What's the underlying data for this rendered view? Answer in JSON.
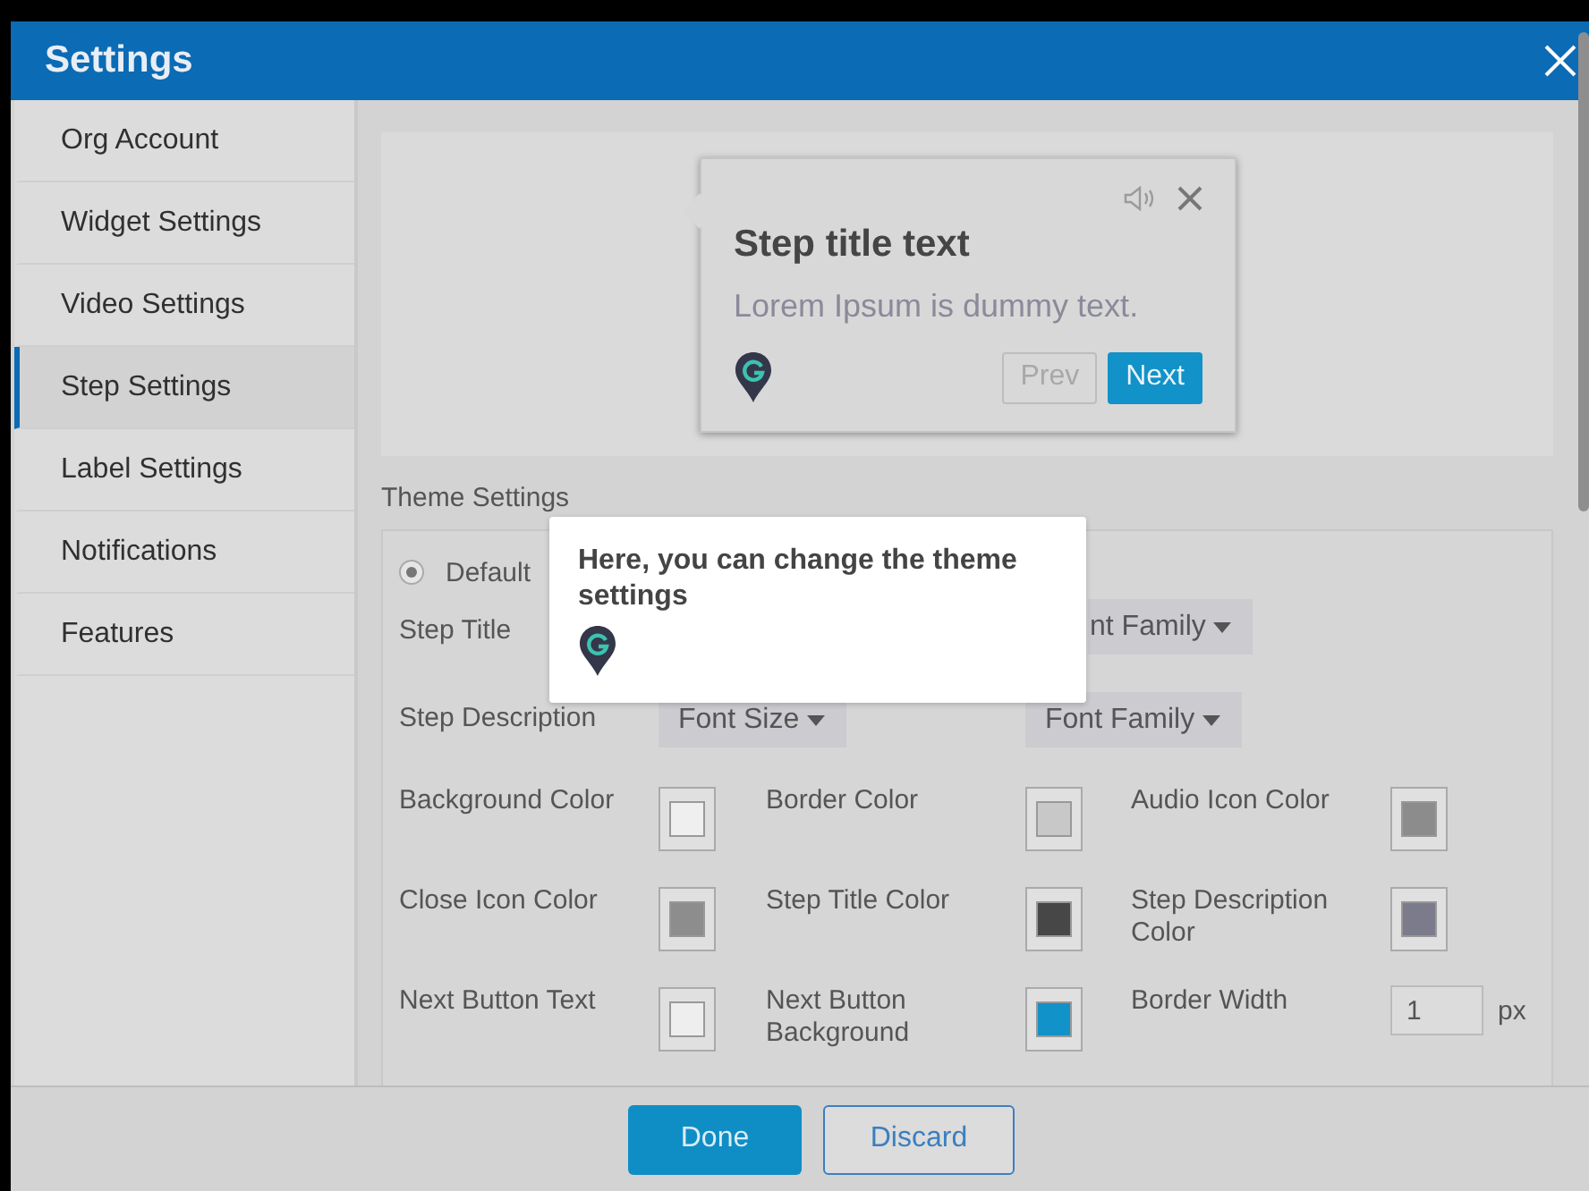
{
  "window": {
    "title": "Settings"
  },
  "sidebar": {
    "items": [
      {
        "label": "Org Account",
        "selected": false
      },
      {
        "label": "Widget Settings",
        "selected": false
      },
      {
        "label": "Video Settings",
        "selected": false
      },
      {
        "label": "Step Settings",
        "selected": true
      },
      {
        "label": "Label Settings",
        "selected": false
      },
      {
        "label": "Notifications",
        "selected": false
      },
      {
        "label": "Features",
        "selected": false
      }
    ]
  },
  "preview": {
    "title": "Step title text",
    "description": "Lorem Ipsum is dummy text.",
    "buttons": [
      {
        "label": "Prev",
        "kind": "secondary"
      },
      {
        "label": "Next",
        "kind": "primary"
      }
    ]
  },
  "theme": {
    "heading": "Theme Settings",
    "options": [
      {
        "label": "Default",
        "selected": true
      }
    ],
    "font_rows": [
      {
        "label": "Step Title",
        "font_family": "nt Family"
      },
      {
        "label": "Step Description",
        "font_size": "Font Size",
        "font_family": "Font Family"
      }
    ],
    "color_settings": [
      {
        "label": "Background Color",
        "kind": "swatch",
        "color": "#efefef"
      },
      {
        "label": "Border Color",
        "kind": "swatch",
        "color": "#c8c8c8"
      },
      {
        "label": "Audio Icon Color",
        "kind": "swatch",
        "color": "#8c8c8c"
      },
      {
        "label": "Close Icon Color",
        "kind": "swatch",
        "color": "#8d8d8d"
      },
      {
        "label": "Step Title Color",
        "kind": "swatch",
        "color": "#474747"
      },
      {
        "label": "Step Description Color",
        "kind": "swatch",
        "color": "#7b7b8c"
      },
      {
        "label": "Next Button Text",
        "kind": "swatch",
        "color": "#eeeeee"
      },
      {
        "label": "Next Button Background",
        "kind": "swatch",
        "color": "#1192c8"
      },
      {
        "label": "Border Width",
        "kind": "number",
        "value": "1",
        "unit": "px"
      }
    ]
  },
  "tooltip": {
    "text": "Here, you can change the theme settings"
  },
  "footer": {
    "buttons": [
      {
        "label": "Done",
        "kind": "primary"
      },
      {
        "label": "Discard",
        "kind": "secondary"
      }
    ]
  }
}
